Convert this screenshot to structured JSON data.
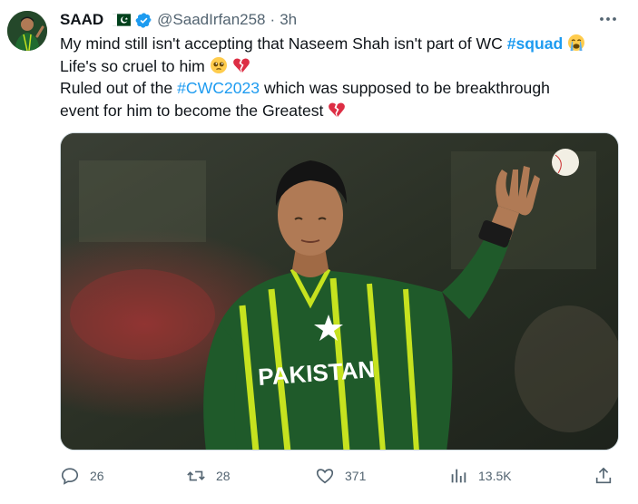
{
  "author": {
    "display_name": "SAAD",
    "handle": "@SaadIrfan258",
    "separator": "·",
    "timestamp": "3h",
    "flag": "pakistan-flag",
    "verified": true
  },
  "tweet": {
    "line1_pre": "My mind still isn't accepting that Naseem Shah isn't part of WC ",
    "hashtag1": "#squad",
    "line2": "Life's so cruel to him",
    "line3_pre": "Ruled out of the ",
    "hashtag2": "#CWC2023",
    "line3_post": " which was supposed to be breakthrough",
    "line4": "event for him to become the Greatest"
  },
  "media": {
    "jersey_text": "PAKISTAN"
  },
  "actions": {
    "replies": "26",
    "retweets": "28",
    "likes": "371",
    "views": "13.5K"
  },
  "colors": {
    "accent": "#1d9bf0",
    "text": "#0f1419",
    "muted": "#536471",
    "jersey_green": "#1f5a2a",
    "jersey_stripe": "#c6e21f"
  }
}
